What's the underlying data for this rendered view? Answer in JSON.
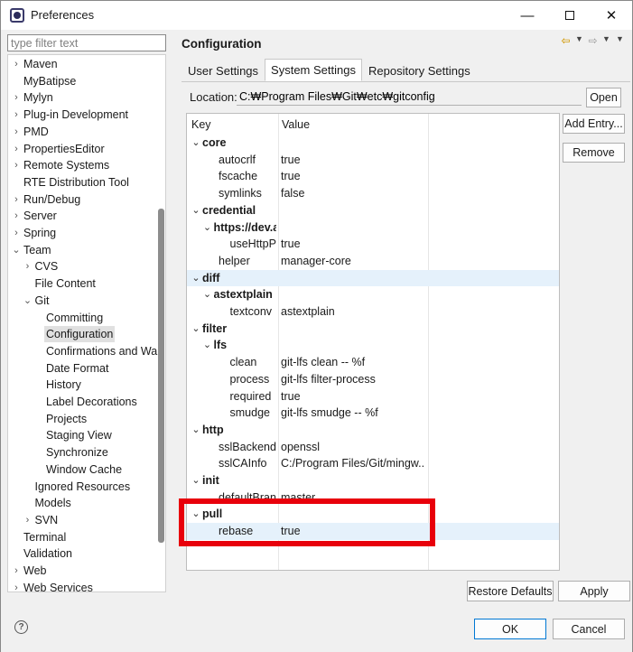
{
  "window": {
    "title": "Preferences",
    "minimize": "—",
    "close": "✕"
  },
  "filter": {
    "placeholder": "type filter text",
    "value": ""
  },
  "tree": [
    {
      "label": "Maven",
      "chev": "›",
      "indent": 0
    },
    {
      "label": "MyBatipse",
      "chev": "",
      "indent": 0
    },
    {
      "label": "Mylyn",
      "chev": "›",
      "indent": 0
    },
    {
      "label": "Plug-in Development",
      "chev": "›",
      "indent": 0
    },
    {
      "label": "PMD",
      "chev": "›",
      "indent": 0
    },
    {
      "label": "PropertiesEditor",
      "chev": "›",
      "indent": 0
    },
    {
      "label": "Remote Systems",
      "chev": "›",
      "indent": 0
    },
    {
      "label": "RTE Distribution Tool",
      "chev": "",
      "indent": 0
    },
    {
      "label": "Run/Debug",
      "chev": "›",
      "indent": 0
    },
    {
      "label": "Server",
      "chev": "›",
      "indent": 0
    },
    {
      "label": "Spring",
      "chev": "›",
      "indent": 0
    },
    {
      "label": "Team",
      "chev": "⌄",
      "indent": 0
    },
    {
      "label": "CVS",
      "chev": "›",
      "indent": 1
    },
    {
      "label": "File Content",
      "chev": "",
      "indent": 1
    },
    {
      "label": "Git",
      "chev": "⌄",
      "indent": 1
    },
    {
      "label": "Committing",
      "chev": "",
      "indent": 2
    },
    {
      "label": "Configuration",
      "chev": "",
      "indent": 2,
      "selected": true
    },
    {
      "label": "Confirmations and Wa",
      "chev": "",
      "indent": 2
    },
    {
      "label": "Date Format",
      "chev": "",
      "indent": 2
    },
    {
      "label": "History",
      "chev": "",
      "indent": 2
    },
    {
      "label": "Label Decorations",
      "chev": "",
      "indent": 2
    },
    {
      "label": "Projects",
      "chev": "",
      "indent": 2
    },
    {
      "label": "Staging View",
      "chev": "",
      "indent": 2
    },
    {
      "label": "Synchronize",
      "chev": "",
      "indent": 2
    },
    {
      "label": "Window Cache",
      "chev": "",
      "indent": 2
    },
    {
      "label": "Ignored Resources",
      "chev": "",
      "indent": 1
    },
    {
      "label": "Models",
      "chev": "",
      "indent": 1
    },
    {
      "label": "SVN",
      "chev": "›",
      "indent": 1
    },
    {
      "label": "Terminal",
      "chev": "",
      "indent": 0
    },
    {
      "label": "Validation",
      "chev": "",
      "indent": 0
    },
    {
      "label": "Web",
      "chev": "›",
      "indent": 0
    },
    {
      "label": "Web Services",
      "chev": "›",
      "indent": 0
    }
  ],
  "page": {
    "title": "Configuration",
    "tabs": [
      "User Settings",
      "System Settings",
      "Repository Settings"
    ],
    "active_tab": 1,
    "location_label": "Location:",
    "location_value": "C:₩Program Files₩Git₩etc₩gitconfig",
    "open_button": "Open",
    "add_entry_button": "Add Entry...",
    "remove_button": "Remove",
    "restore_defaults_button": "Restore Defaults",
    "apply_button": "Apply",
    "ok_button": "OK",
    "cancel_button": "Cancel",
    "help_icon": "?"
  },
  "table": {
    "headers": [
      "Key",
      "Value"
    ],
    "rows": [
      {
        "key": "core",
        "value": "",
        "level": 0,
        "section": true,
        "twisty": "⌄"
      },
      {
        "key": "autocrlf",
        "value": "true",
        "level": 2
      },
      {
        "key": "fscache",
        "value": "true",
        "level": 2
      },
      {
        "key": "symlinks",
        "value": "false",
        "level": 2
      },
      {
        "key": "credential",
        "value": "",
        "level": 0,
        "section": true,
        "twisty": "⌄"
      },
      {
        "key": "https://dev.a",
        "value": "",
        "level": 1,
        "section": true,
        "twisty": "⌄"
      },
      {
        "key": "useHttpPat",
        "value": "true",
        "level": 3
      },
      {
        "key": "helper",
        "value": "manager-core",
        "level": 2
      },
      {
        "key": "diff",
        "value": "",
        "level": 0,
        "section": true,
        "twisty": "⌄",
        "highlight": true
      },
      {
        "key": "astextplain",
        "value": "",
        "level": 1,
        "section": true,
        "twisty": "⌄"
      },
      {
        "key": "textconv",
        "value": "astextplain",
        "level": 3
      },
      {
        "key": "filter",
        "value": "",
        "level": 0,
        "section": true,
        "twisty": "⌄"
      },
      {
        "key": "lfs",
        "value": "",
        "level": 1,
        "section": true,
        "twisty": "⌄"
      },
      {
        "key": "clean",
        "value": "git-lfs clean -- %f",
        "level": 3
      },
      {
        "key": "process",
        "value": "git-lfs filter-process",
        "level": 3
      },
      {
        "key": "required",
        "value": "true",
        "level": 3
      },
      {
        "key": "smudge",
        "value": "git-lfs smudge -- %f",
        "level": 3
      },
      {
        "key": "http",
        "value": "",
        "level": 0,
        "section": true,
        "twisty": "⌄"
      },
      {
        "key": "sslBackend",
        "value": "openssl",
        "level": 2
      },
      {
        "key": "sslCAInfo",
        "value": "C:/Program Files/Git/mingw...",
        "level": 2
      },
      {
        "key": "init",
        "value": "",
        "level": 0,
        "section": true,
        "twisty": "⌄"
      },
      {
        "key": "defaultBranch",
        "value": "master",
        "level": 2
      },
      {
        "key": "pull",
        "value": "",
        "level": 0,
        "section": true,
        "twisty": "⌄"
      },
      {
        "key": "rebase",
        "value": "true",
        "level": 2,
        "highlight": true
      }
    ]
  },
  "colors": {
    "highlight_box": "#e8000b",
    "row_highlight": "#e5f1fb",
    "ok_border": "#0078d4"
  }
}
